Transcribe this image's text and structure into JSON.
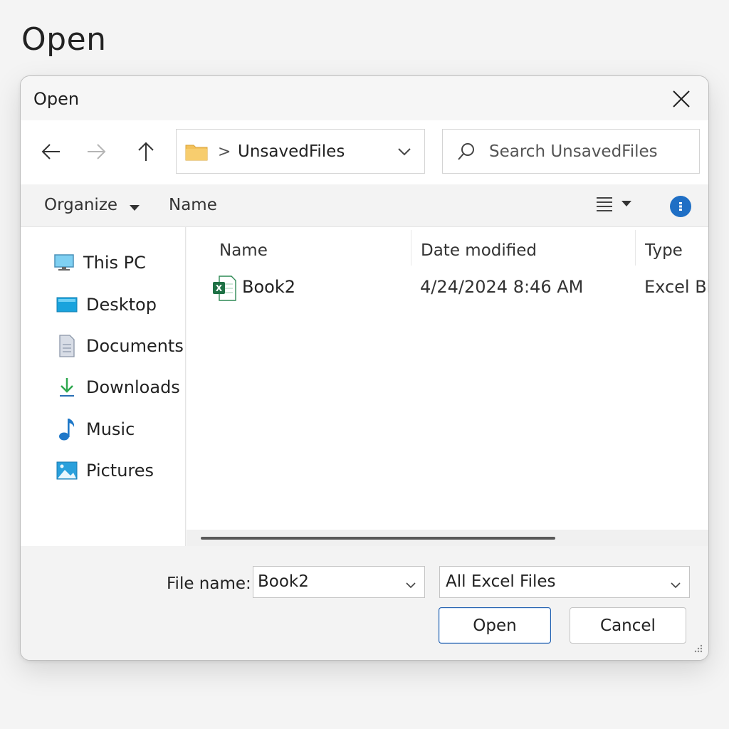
{
  "page": {
    "heading": "Open"
  },
  "dialog": {
    "title": "Open",
    "nav": {
      "back_icon": "back-arrow-icon",
      "forward_icon": "forward-arrow-icon",
      "up_icon": "up-arrow-icon"
    },
    "address": {
      "folder_icon": "folder-icon",
      "separator": ">",
      "path": "UnsavedFiles"
    },
    "search": {
      "placeholder": "Search UnsavedFiles"
    },
    "commandbar": {
      "organize": "Organize",
      "name": "Name"
    },
    "sidebar": {
      "items": [
        {
          "label": "This PC",
          "icon": "computer-icon"
        },
        {
          "label": "Desktop",
          "icon": "desktop-icon"
        },
        {
          "label": "Documents",
          "icon": "documents-icon"
        },
        {
          "label": "Downloads",
          "icon": "download-arrow-icon"
        },
        {
          "label": "Music",
          "icon": "music-note-icon"
        },
        {
          "label": "Pictures",
          "icon": "pictures-icon"
        }
      ]
    },
    "files": {
      "columns": [
        "Name",
        "Date modified",
        "Type"
      ],
      "rows": [
        {
          "name": "Book2",
          "date": "4/24/2024 8:46 AM",
          "type": "Excel Bi",
          "icon": "excel-file-icon"
        }
      ]
    },
    "bottom": {
      "filename_label": "File name:",
      "filename_value": "Book2",
      "filetype_value": "All Excel Files",
      "open_label": "Open",
      "cancel_label": "Cancel"
    },
    "colors": {
      "accent": "#1f6fc5",
      "excel_green": "#1e7145",
      "folder_yellow": "#f3c15a"
    }
  }
}
